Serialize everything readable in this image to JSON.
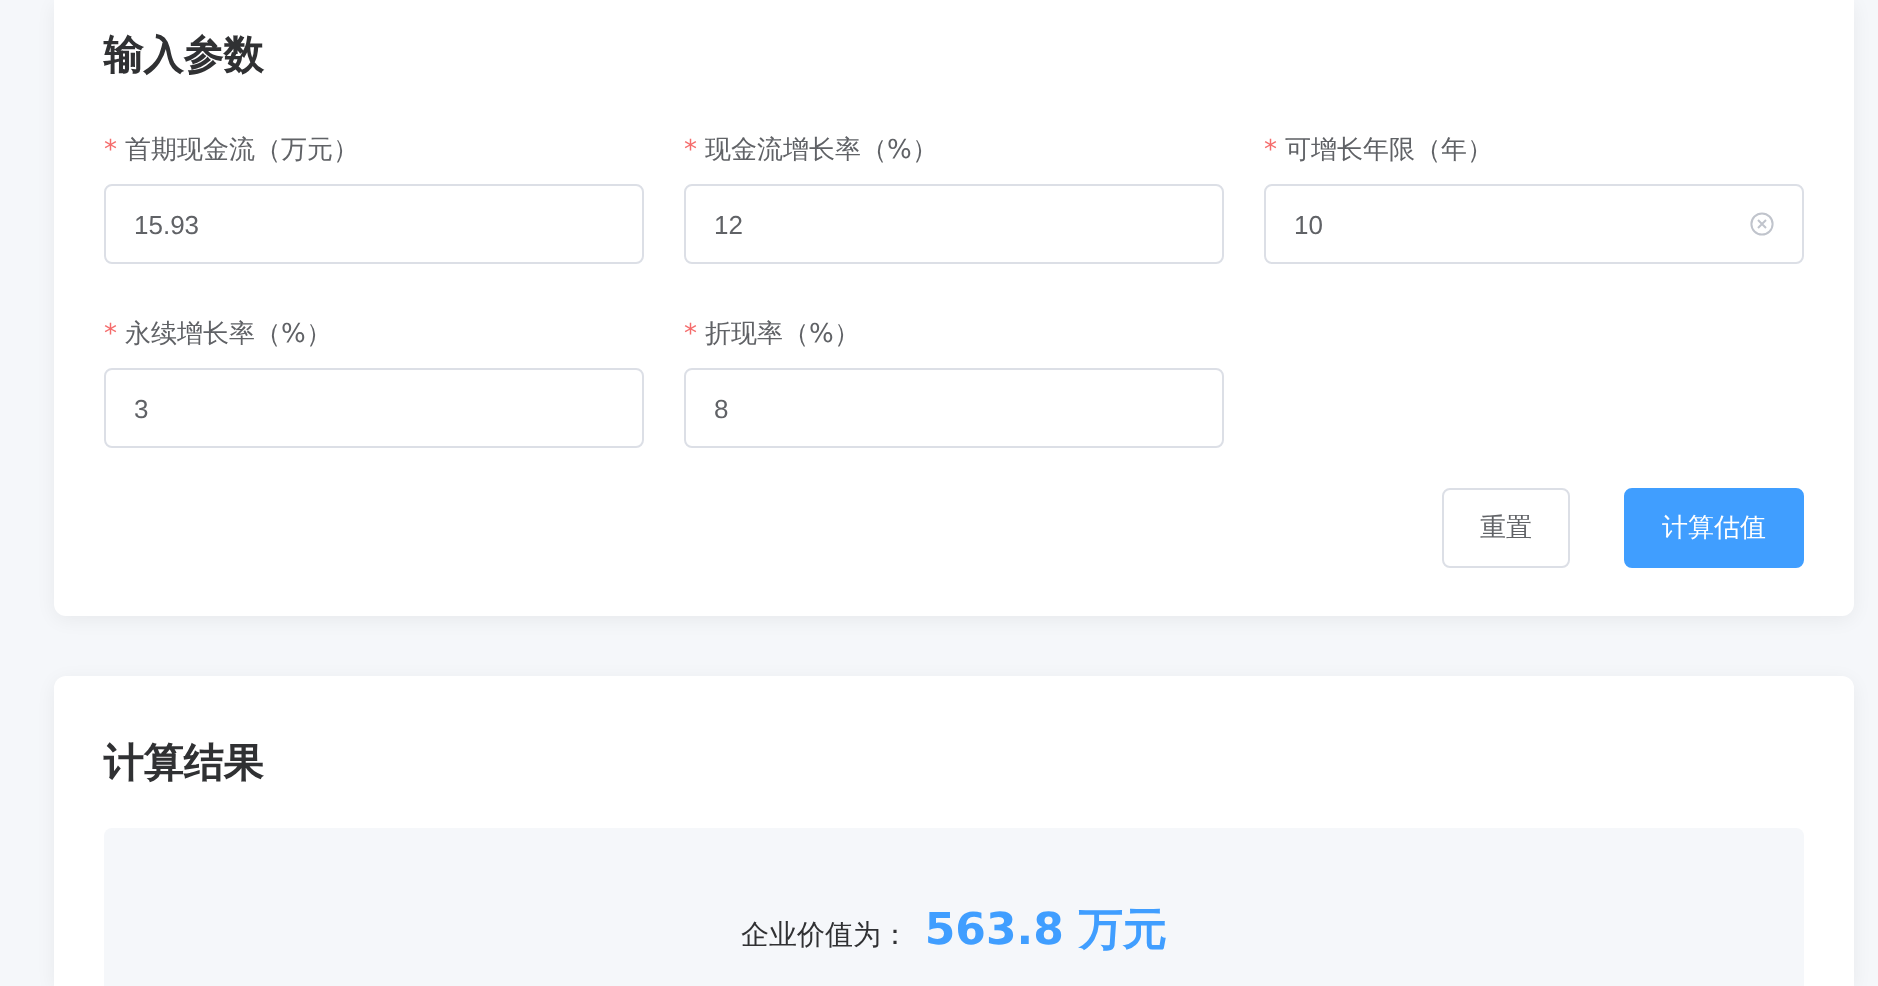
{
  "input_section": {
    "title": "输入参数",
    "fields": [
      {
        "required_mark": "*",
        "label": "首期现金流（万元）",
        "value": "15.93",
        "clearable": false
      },
      {
        "required_mark": "*",
        "label": "现金流增长率（%）",
        "value": "12",
        "clearable": false
      },
      {
        "required_mark": "*",
        "label": "可增长年限（年）",
        "value": "10",
        "clearable": true
      },
      {
        "required_mark": "*",
        "label": "永续增长率（%）",
        "value": "3",
        "clearable": false
      },
      {
        "required_mark": "*",
        "label": "折现率（%）",
        "value": "8",
        "clearable": false
      }
    ],
    "buttons": [
      {
        "label": "重置",
        "kind": "default"
      },
      {
        "label": "计算估值",
        "kind": "primary"
      }
    ]
  },
  "result_section": {
    "title": "计算结果",
    "result_label": "企业价值为：",
    "result_value": "563.8 万元"
  }
}
